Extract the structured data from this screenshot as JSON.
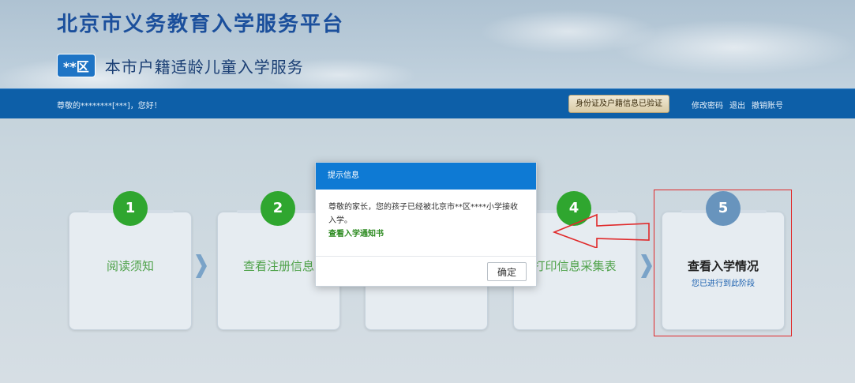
{
  "header": {
    "site_title": "北京市义务教育入学服务平台",
    "district_badge": "**区",
    "subtitle": "本市户籍适龄儿童入学服务"
  },
  "navbar": {
    "greeting": "尊敬的********[***]，您好！",
    "verified_badge": "身份证及户籍信息已验证",
    "links": [
      "修改密码",
      "退出",
      "撤销账号"
    ]
  },
  "steps": [
    {
      "number": "1",
      "label": "阅读须知",
      "status": "done"
    },
    {
      "number": "2",
      "label": "查看注册信息",
      "status": "done"
    },
    {
      "number": "3",
      "label": "",
      "status": "done"
    },
    {
      "number": "4",
      "label": "打印信息采集表",
      "status": "done"
    },
    {
      "number": "5",
      "label": "查看入学情况",
      "sublabel": "您已进行到此阶段",
      "status": "current"
    }
  ],
  "modal": {
    "title": "提示信息",
    "message": "尊敬的家长，您的孩子已经被北京市**区****小学接收入学。",
    "link": "查看入学通知书",
    "ok_label": "确定"
  },
  "colors": {
    "brand_blue": "#0d5fa8",
    "step_green": "#2fa62f",
    "step_current": "#6894bd",
    "highlight_red": "#e0292a"
  }
}
